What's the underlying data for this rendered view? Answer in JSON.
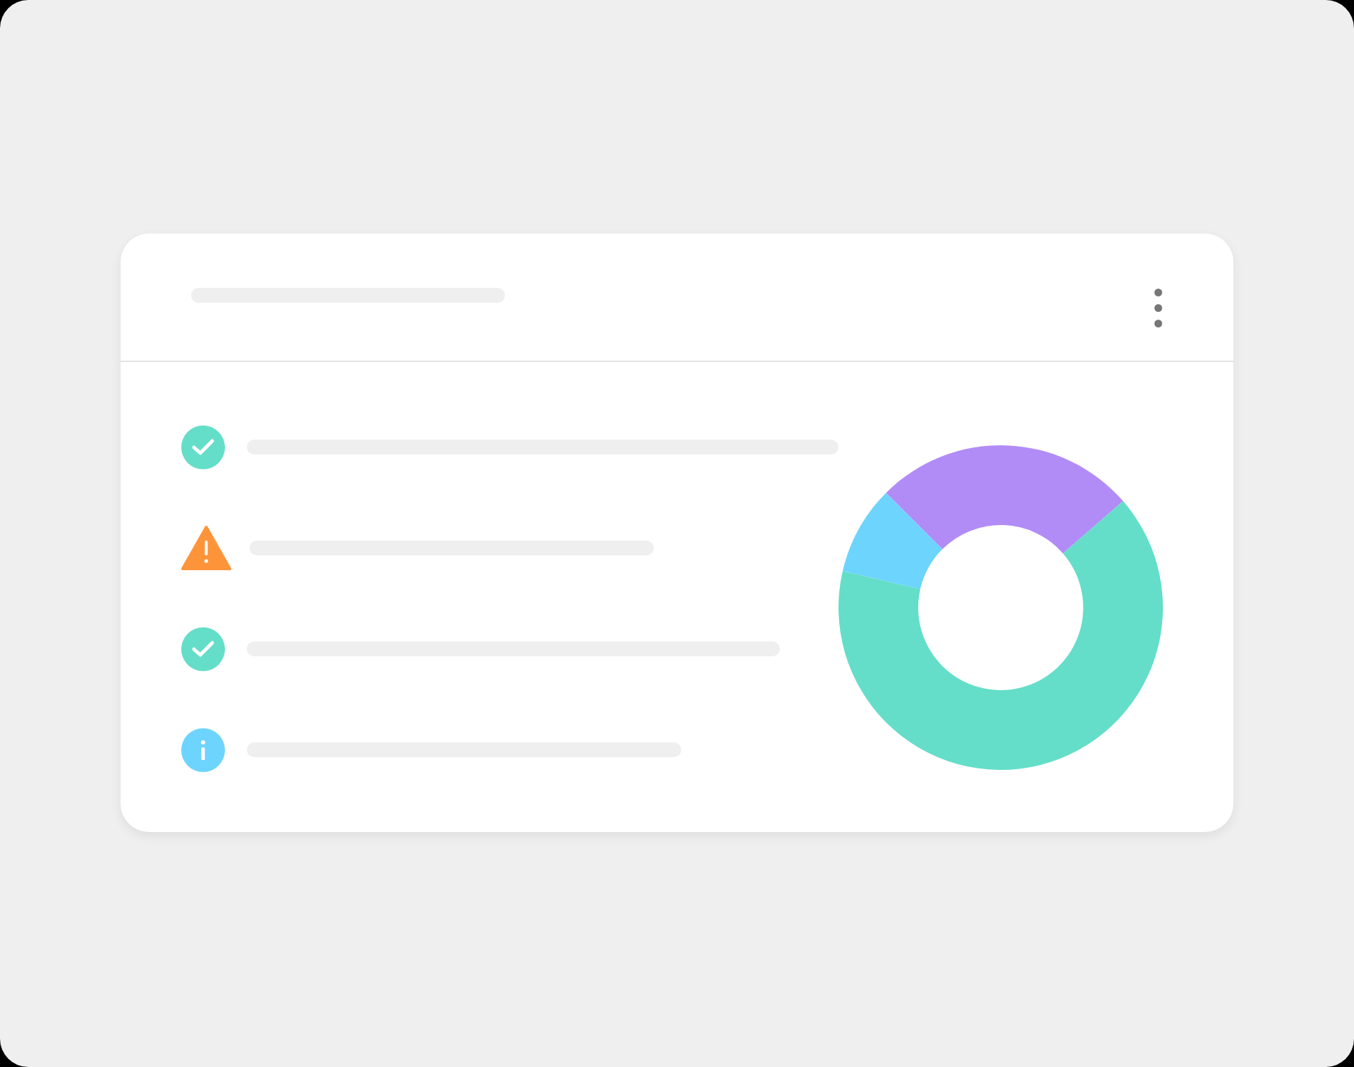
{
  "card": {
    "status_items": [
      {
        "kind": "success"
      },
      {
        "kind": "warning"
      },
      {
        "kind": "success"
      },
      {
        "kind": "info"
      }
    ]
  }
}
